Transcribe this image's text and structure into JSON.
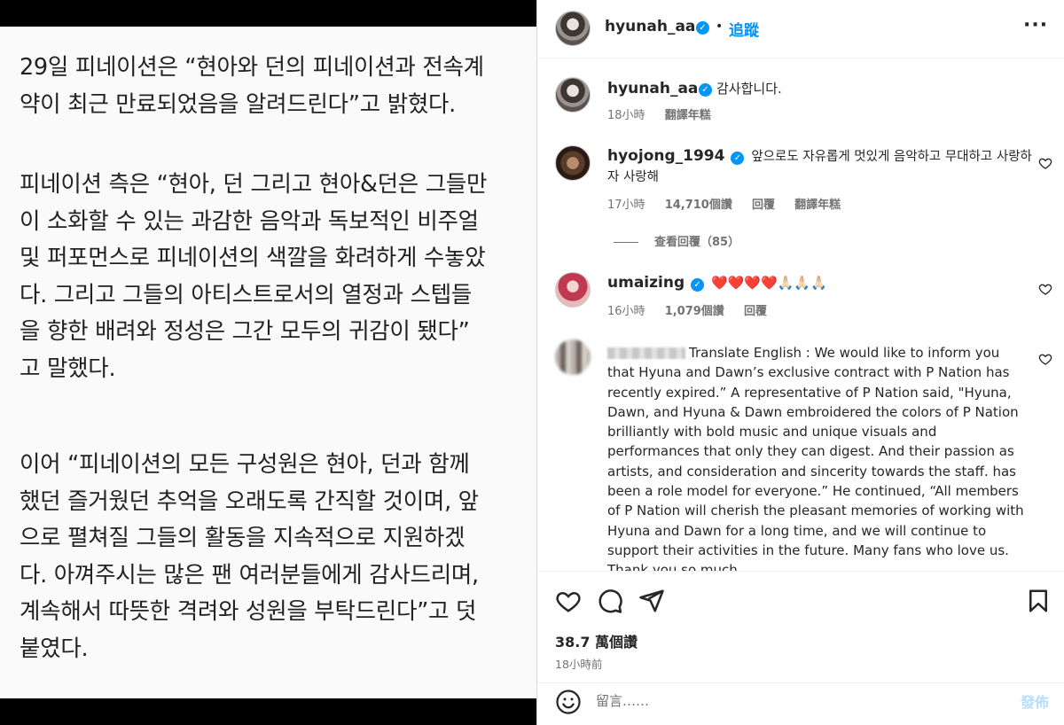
{
  "article": {
    "paragraphs": [
      [
        "29일 피네이션은 “현아와 던의 피네이션과 전속계",
        "약이 최근 만료되었음을 알려드린다”고 밝혔다."
      ],
      [
        "피네이션 측은 “현아, 던 그리고 현아&던은 그들만",
        "이 소화할 수 있는 과감한 음악과 독보적인 비주얼",
        "및 퍼포먼스로 피네이션의 색깔을 화려하게 수놓았",
        "다. 그리고 그들의 아티스트로서의 열정과 스텝들",
        "을 향한 배려와 정성은 그간 모두의 귀감이 됐다”",
        "고 말했다."
      ],
      [
        "이어 “피네이션의 모든 구성원은 현아, 던과 함께",
        "했던 즐거웠던 추억을 오래도록 간직할 것이며, 앞",
        "으로 펼쳐질 그들의 활동을 지속적으로 지원하겠",
        "다. 아껴주시는 많은 팬 여러분들에게 감사드리며,",
        "계속해서 따뜻한 격려와 성원을 부탁드린다”고 덧",
        "붙였다."
      ]
    ]
  },
  "header": {
    "username": "hyunah_aa",
    "verified_icon": "✓",
    "separator": "•",
    "follow_label": "追蹤",
    "more_label": "···"
  },
  "caption": {
    "username": "hyunah_aa",
    "text": "감사합니다.",
    "time": "18小時",
    "translate": "翻譯年糕"
  },
  "comments": [
    {
      "username": "hyojong_1994",
      "text": "앞으로도 자유롭게 멋있게 음악하고 무대하고 사랑하자 사랑해",
      "time": "17小時",
      "likes": "14,710個讚",
      "reply": "回覆",
      "translate": "翻譯年糕",
      "view_replies": "查看回覆（85）"
    },
    {
      "username": "umaizing",
      "text": "❤️❤️❤️❤️🙏🏻🙏🏻🙏🏻",
      "time": "16小時",
      "likes": "1,079個讚",
      "reply": "回覆"
    },
    {
      "text": "Translate English : We would like to inform you that Hyuna and Dawn’s exclusive contract with P Nation has recently expired.” A representative of P Nation said, \"Hyuna, Dawn, and Hyuna & Dawn embroidered the colors of P Nation brilliantly with bold music and unique visuals and performances that only they can digest. And their passion as artists, and consideration and sincerity towards the staff. has been a role model for everyone.” He continued, “All members of P Nation will cherish the pleasant memories of working with Hyuna and Dawn for a long time, and we will continue to support their activities in the future. Many fans who love us. Thank you so much."
    }
  ],
  "post": {
    "likes": "38.7 萬個讚",
    "time": "18小時前"
  },
  "composer": {
    "placeholder": "留言……",
    "post_label": "發佈"
  },
  "colors": {
    "accent": "#0095f6",
    "post_disabled": "#b2dffc",
    "muted": "#737373"
  }
}
